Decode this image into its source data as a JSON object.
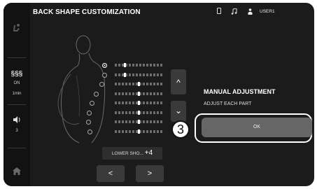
{
  "header": {
    "title": "BACK SHAPE CUSTOMIZATION",
    "user_label": "USER1",
    "icons": [
      "phone-icon",
      "music-note-icon",
      "user-icon"
    ]
  },
  "sidebar": {
    "items": [
      {
        "icon": "recline-chair-icon"
      },
      {
        "icon": "heat-waves-icon",
        "status": "ON",
        "value": "1min"
      },
      {
        "icon": "speaker-icon",
        "value": "3"
      },
      {
        "icon": "home-icon"
      }
    ]
  },
  "adjustment": {
    "bar_markers": [
      0.18,
      0.18,
      0.47,
      0.47,
      0.47,
      0.47,
      0.47,
      0.47
    ],
    "selected_point": 0,
    "part_label": "LOWER SHO...",
    "part_value": "+4",
    "up_label": "^",
    "down_label": "⌄",
    "prev_label": "<",
    "next_label": ">"
  },
  "panel": {
    "heading": "MANUAL ADJUSTMENT",
    "subtext": "ADJUST EACH PART",
    "ok_label": "OK"
  },
  "callout": {
    "number": "3"
  }
}
